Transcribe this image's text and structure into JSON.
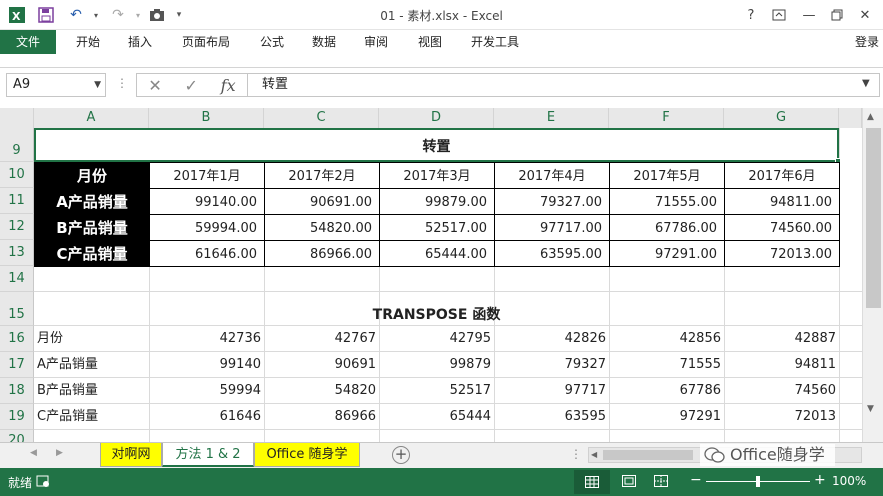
{
  "window": {
    "title": "01 - 素材.xlsx - Excel",
    "help": "?",
    "login": "登录"
  },
  "ribbon": {
    "tabs": [
      "文件",
      "开始",
      "插入",
      "页面布局",
      "公式",
      "数据",
      "审阅",
      "视图",
      "开发工具"
    ]
  },
  "formula_bar": {
    "name_box": "A9",
    "cancel_glyph": "✕",
    "enter_glyph": "✓",
    "fx_glyph": "fx",
    "value": "转置"
  },
  "columns": [
    "A",
    "B",
    "C",
    "D",
    "E",
    "F",
    "G"
  ],
  "rows": [
    "9",
    "10",
    "11",
    "12",
    "13",
    "14",
    "15",
    "16",
    "17",
    "18",
    "19",
    "20"
  ],
  "table1": {
    "title": "转置",
    "header_label": "月份",
    "months": [
      "2017年1月",
      "2017年2月",
      "2017年3月",
      "2017年4月",
      "2017年5月",
      "2017年6月"
    ],
    "rows": [
      {
        "label": "A产品销量",
        "values": [
          "99140.00",
          "90691.00",
          "99879.00",
          "79327.00",
          "71555.00",
          "94811.00"
        ]
      },
      {
        "label": "B产品销量",
        "values": [
          "59994.00",
          "54820.00",
          "52517.00",
          "97717.00",
          "67786.00",
          "74560.00"
        ]
      },
      {
        "label": "C产品销量",
        "values": [
          "61646.00",
          "86966.00",
          "65444.00",
          "63595.00",
          "97291.00",
          "72013.00"
        ]
      }
    ]
  },
  "table2": {
    "title": "TRANSPOSE 函数",
    "rows": [
      {
        "label": "月份",
        "values": [
          "42736",
          "42767",
          "42795",
          "42826",
          "42856",
          "42887"
        ]
      },
      {
        "label": "A产品销量",
        "values": [
          "99140",
          "90691",
          "99879",
          "79327",
          "71555",
          "94811"
        ]
      },
      {
        "label": "B产品销量",
        "values": [
          "59994",
          "54820",
          "52517",
          "97717",
          "67786",
          "74560"
        ]
      },
      {
        "label": "C产品销量",
        "values": [
          "61646",
          "86966",
          "65444",
          "63595",
          "97291",
          "72013"
        ]
      }
    ]
  },
  "sheet_tabs": [
    {
      "label": "对啊网",
      "color": "#ffff00",
      "active": false
    },
    {
      "label": "方法 1 & 2",
      "color": "#ffffff",
      "active": true
    },
    {
      "label": "Office 随身学",
      "color": "#ffff00",
      "active": false
    }
  ],
  "add_sheet": "+",
  "watermark": "Office随身学",
  "status": {
    "ready": "就绪",
    "zoom": "100%",
    "zoom_minus": "−",
    "zoom_plus": "+"
  },
  "colors": {
    "excel_green": "#217346",
    "header_fill": "#000000",
    "tab_yellow": "#ffff00"
  }
}
